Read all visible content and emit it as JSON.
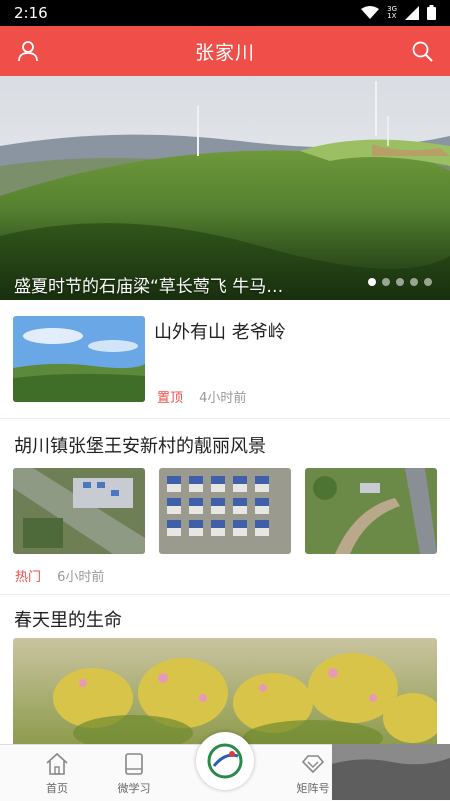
{
  "status": {
    "time": "2:16",
    "network": "3G",
    "network2": "1X"
  },
  "header": {
    "title": "张家川",
    "left_icon": "user-icon",
    "right_icon": "search-icon"
  },
  "banner": {
    "caption": "盛夏时节的石庙梁“草长莺飞 牛马…",
    "page_count": 5,
    "active_index": 0
  },
  "articles": [
    {
      "title": "山外有山 老爷岭",
      "tag": "置顶",
      "time": "4小时前"
    },
    {
      "title": "胡川镇张堡王安新村的靓丽风景",
      "tag": "热门",
      "time": "6小时前"
    },
    {
      "title": "春天里的生命"
    }
  ],
  "tabs": [
    {
      "label": "首页",
      "icon": "home-icon"
    },
    {
      "label": "微学习",
      "icon": "book-icon"
    },
    {
      "label": "",
      "icon": "app-logo-icon"
    },
    {
      "label": "矩阵号",
      "icon": "diamond-icon"
    }
  ],
  "colors": {
    "brand": "#ef4f48",
    "tag": "#ef4f48",
    "meta": "#999999"
  }
}
